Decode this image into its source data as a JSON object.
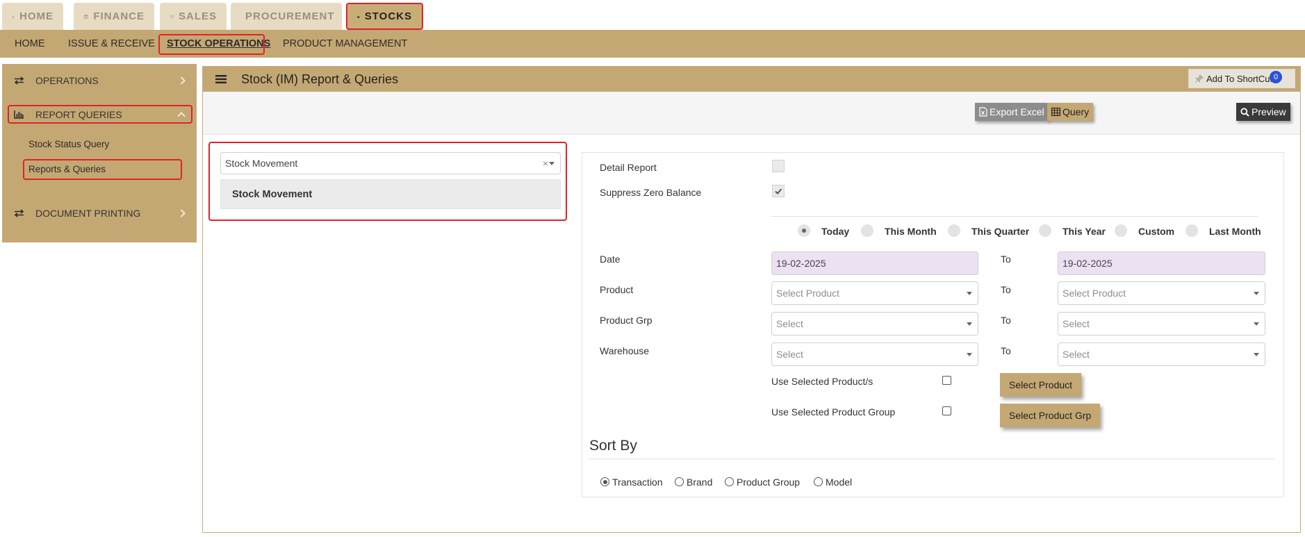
{
  "modules": {
    "home": "HOME",
    "finance": "FINANCE",
    "sales": "SALES",
    "procurement": "PROCUREMENT",
    "stocks": "STOCKS"
  },
  "subnav": {
    "home": "HOME",
    "issue_receive": "ISSUE & RECEIVE",
    "stock_operations": "STOCK OPERATIONS",
    "product_management": "PRODUCT MANAGEMENT"
  },
  "sidebar": {
    "operations": "OPERATIONS",
    "report_queries": "REPORT QUERIES",
    "sub_items": [
      "Stock Status Query",
      "Reports & Queries"
    ],
    "document_printing": "DOCUMENT PRINTING"
  },
  "panel": {
    "title": "Stock (IM) Report & Queries",
    "shortcut_label": "Add To ShortCut",
    "shortcut_count": "0",
    "export_excel": "Export Excel",
    "query": "Query",
    "preview": "Preview"
  },
  "report_select": {
    "value": "Stock Movement",
    "clear": "×",
    "option": "Stock Movement"
  },
  "form": {
    "detail_report": "Detail Report",
    "suppress_zero_balance": "Suppress Zero Balance",
    "suppress_checked": true,
    "periods": [
      "Today",
      "This Month",
      "This Quarter",
      "This Year",
      "Custom",
      "Last Month"
    ],
    "selected_period": "Today",
    "date_label": "Date",
    "date_from": "19-02-2025",
    "to_label": "To",
    "date_to": "19-02-2025",
    "product_label": "Product",
    "product_placeholder": "Select Product",
    "product_grp_label": "Product Grp",
    "warehouse_label": "Warehouse",
    "select_placeholder": "Select",
    "use_selected_products": "Use Selected Product/s",
    "use_selected_group": "Use Selected Product Group",
    "select_product_btn": "Select Product",
    "select_product_grp_btn": "Select Product Grp"
  },
  "sort_by": {
    "title": "Sort By",
    "options": [
      "Transaction",
      "Brand",
      "Product Group",
      "Model"
    ],
    "selected": "Transaction"
  },
  "colors": {
    "accent": "#c4a873",
    "highlight": "#e0222a",
    "tab_inactive": "#e7dcc3",
    "date_bg": "#ece1f3",
    "badge": "#2a52d6"
  }
}
